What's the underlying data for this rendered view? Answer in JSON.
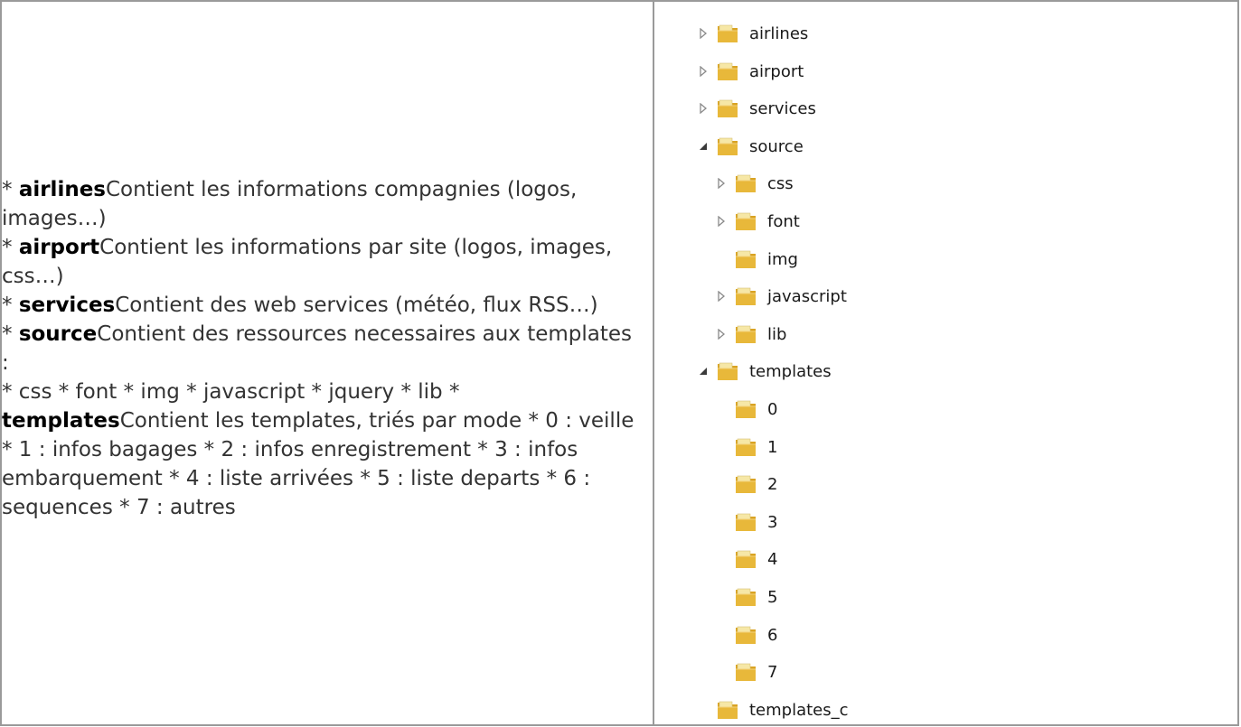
{
  "description": {
    "paragraphs": [
      {
        "star": "* ",
        "bold": "airlines",
        "text": "Contient les informations compagnies (logos, images…)"
      },
      {
        "star": "* ",
        "bold": "airport",
        "text": "Contient les informations par site (logos, images, css…)"
      },
      {
        "star": "* ",
        "bold": "services",
        "text": "Contient des web services (météo, flux RSS…)"
      },
      {
        "star": "* ",
        "bold": "source",
        "text": "Contient des ressources necessaires aux templates :"
      },
      {
        "star": "* css * font * img * javascript * jquery * lib * ",
        "bold": "templates",
        "text": "Contient les templates, triés par mode * 0 : veille * 1 : infos bagages * 2 : infos enregistrement * 3 : infos embarquement * 4 : liste arrivées * 5 : liste departs * 6 : sequences * 7 : autres"
      }
    ]
  },
  "folder_tree": {
    "colors": {
      "folder_body": "#e8b83a",
      "folder_back": "#d9a323",
      "folder_paper": "#f6e7a6",
      "arrow": "#8a8a8a",
      "arrow_expanded": "#3a3a3a"
    },
    "items": [
      {
        "label": "airlines",
        "state": "collapsed",
        "icon": "folder-icon"
      },
      {
        "label": "airport",
        "state": "collapsed",
        "icon": "folder-icon"
      },
      {
        "label": "services",
        "state": "collapsed",
        "icon": "folder-icon"
      },
      {
        "label": "source",
        "state": "expanded",
        "icon": "folder-icon"
      },
      {
        "label": "css",
        "state": "collapsed",
        "icon": "folder-icon"
      },
      {
        "label": "font",
        "state": "collapsed",
        "icon": "folder-icon"
      },
      {
        "label": "img",
        "state": "none",
        "icon": "folder-icon"
      },
      {
        "label": "javascript",
        "state": "collapsed",
        "icon": "folder-icon"
      },
      {
        "label": "lib",
        "state": "collapsed",
        "icon": "folder-icon"
      },
      {
        "label": "templates",
        "state": "expanded",
        "icon": "folder-icon"
      },
      {
        "label": "0",
        "state": "none",
        "icon": "folder-icon"
      },
      {
        "label": "1",
        "state": "none",
        "icon": "folder-icon"
      },
      {
        "label": "2",
        "state": "none",
        "icon": "folder-icon"
      },
      {
        "label": "3",
        "state": "none",
        "icon": "folder-icon"
      },
      {
        "label": "4",
        "state": "none",
        "icon": "folder-icon"
      },
      {
        "label": "5",
        "state": "none",
        "icon": "folder-icon"
      },
      {
        "label": "6",
        "state": "none",
        "icon": "folder-icon"
      },
      {
        "label": "7",
        "state": "none",
        "icon": "folder-icon"
      },
      {
        "label": "templates_c",
        "state": "none",
        "icon": "folder-icon"
      }
    ]
  }
}
